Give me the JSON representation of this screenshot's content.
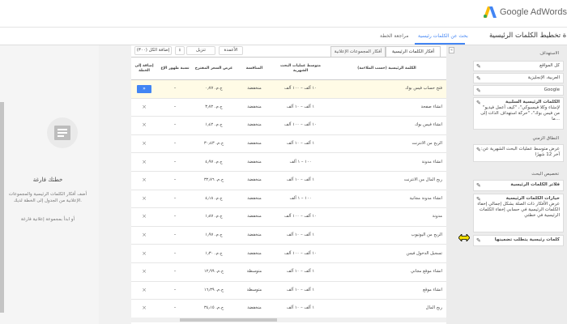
{
  "app": {
    "logo_text": "Google AdWords",
    "logo_colors": [
      "#fbbc05",
      "#34a853",
      "#4285f4"
    ]
  },
  "nav": {
    "title": "أداة تخطيط الكلمات الرئيسية",
    "tabs": [
      {
        "label": "بحث عن الكلمات رئيسية",
        "active": true
      },
      {
        "label": "مراجعة الخطة",
        "active": false
      }
    ]
  },
  "left_panel": {
    "title": "خطتك فارغة",
    "description": "أضف أفكار الكلمات الرئيسية والمجموعات الإعلانية من الجدول إلى الخطة لديك.",
    "link": "أو ابدأ بمجموعة إعلانية فارغة"
  },
  "toolbar": {
    "download_label": "تنزيل",
    "add_all_label": "إضافة الكل (٣٠٠)",
    "columns_label": "الأعمدة"
  },
  "subtabs": [
    {
      "label": "أفكار الكلمات الرئيسية",
      "active": true
    },
    {
      "label": "أفكار المجموعات الإعلانية",
      "active": false
    }
  ],
  "table": {
    "headers": {
      "keyword": "الكلمة الرئيسية (حسب الملاءمة)",
      "volume": "متوسط عمليات البحث الشهرية",
      "competition": "المنافسة",
      "bid": "عرض السعر المقترح",
      "impr": "نسبة ظهور الإع",
      "add": "إضافة إلى الخطة"
    },
    "rows": [
      {
        "keyword": "فتح حساب فيس بوك",
        "volume": "١٠ آلف – ١٠٠ آلف",
        "competition": "منخفضة",
        "bid": "ج.م. ٠٫٧٧",
        "impr": "–",
        "highlight": true,
        "add": "»"
      },
      {
        "keyword": "انشاء صفحة",
        "volume": "١ آلف – ١٠ آلف",
        "competition": "منخفضة",
        "bid": "ج.م. ٣٫٧٢",
        "impr": "–",
        "highlight": false,
        "add": "»"
      },
      {
        "keyword": "انشاء فيس بوك",
        "volume": "١٠ آلف – ١٠٠ آلف",
        "competition": "منخفضة",
        "bid": "ج.م. ١٫٤٢",
        "impr": "–",
        "highlight": false,
        "add": "»"
      },
      {
        "keyword": "الربح من الانترنت",
        "volume": "١ آلف – ١٠ آلف",
        "competition": "منخفضة",
        "bid": "ج.م. ٣٠٫٤٣",
        "impr": "–",
        "highlight": false,
        "add": "»"
      },
      {
        "keyword": "انشاء مدونة",
        "volume": "١٠٠ – ١ آلف",
        "competition": "منخفضة",
        "bid": "ج.م. ٤٫٩٧",
        "impr": "–",
        "highlight": false,
        "add": "»"
      },
      {
        "keyword": "ربح المال من الانترنت",
        "volume": "١ آلف – ١٠ آلف",
        "competition": "منخفضة",
        "bid": "ج.م. ٣٢٫٧٦",
        "impr": "–",
        "highlight": false,
        "add": "»"
      },
      {
        "keyword": "انشاء مدونة مجانية",
        "volume": "١٠٠ – ١ آلف",
        "competition": "منخفضة",
        "bid": "ج.م. ٤٫١٨",
        "impr": "–",
        "highlight": false,
        "add": "»"
      },
      {
        "keyword": "مدونة",
        "volume": "١٠ آلف – ١٠٠ آلف",
        "competition": "منخفضة",
        "bid": "ج.م. ١٫٨٧",
        "impr": "–",
        "highlight": false,
        "add": "»"
      },
      {
        "keyword": "الربح من اليوتيوب",
        "volume": "١ آلف – ١٠ آلف",
        "competition": "منخفضة",
        "bid": "ج.م. ١٫٩٧",
        "impr": "–",
        "highlight": false,
        "add": "»"
      },
      {
        "keyword": "تسجيل الدخول فيس",
        "volume": "١٠ آلف – ١٠٠ آلف",
        "competition": "منخفضة",
        "bid": "ج.م. ١٫٣٠",
        "impr": "–",
        "highlight": false,
        "add": "»"
      },
      {
        "keyword": "انشاء موقع مجاني",
        "volume": "١ آلف – ١٠ آلف",
        "competition": "متوسطة",
        "bid": "ج.م. ١٢٫٩٩",
        "impr": "–",
        "highlight": false,
        "add": "»"
      },
      {
        "keyword": "انشاء موقع",
        "volume": "١ آلف – ١٠ آلف",
        "competition": "متوسطة",
        "bid": "ج.م. ١٦٫٣٩",
        "impr": "–",
        "highlight": false,
        "add": "»"
      },
      {
        "keyword": "ربح المال",
        "volume": "١ آلف – ١٠ آلف",
        "competition": "منخفضة",
        "bid": "ج.م. ٣٤٫١٥",
        "impr": "–",
        "highlight": false,
        "add": "»"
      }
    ]
  },
  "sidebar": {
    "section_targeting": "الاستهداف",
    "targeting_items": [
      "كل المواقع",
      "العربية، الإنجليزية",
      "Google"
    ],
    "negative_keywords": {
      "title": "الكلمات الرئيسية السلبية",
      "text": "\"لإنشاء وكلا فيسبوكي\"، \"كيف أعمل فيديو من فيس بوك\"، \"حركة استهداف الذات إلى ما..."
    },
    "section_date": "النطاق الزمني",
    "date_text": "عرض متوسط عمليات البحث الشهرية عن: آخر 12 شهرًا",
    "section_custom": "تخصيص البحث",
    "filter_label": "فلاتر الكلمات الرئيسية",
    "options": {
      "title": "خيارات الكلمات الرئيسية",
      "text": "عرض الأفكار ذات الصلة بشكل إجمالي إخفاء الكلمات الرئيسية في حسابي إخفاء الكلمات الرئيسية في خطتي"
    },
    "include_label": "كلمات رئيسية يتطلب تضمينها",
    "collapse": "«"
  }
}
